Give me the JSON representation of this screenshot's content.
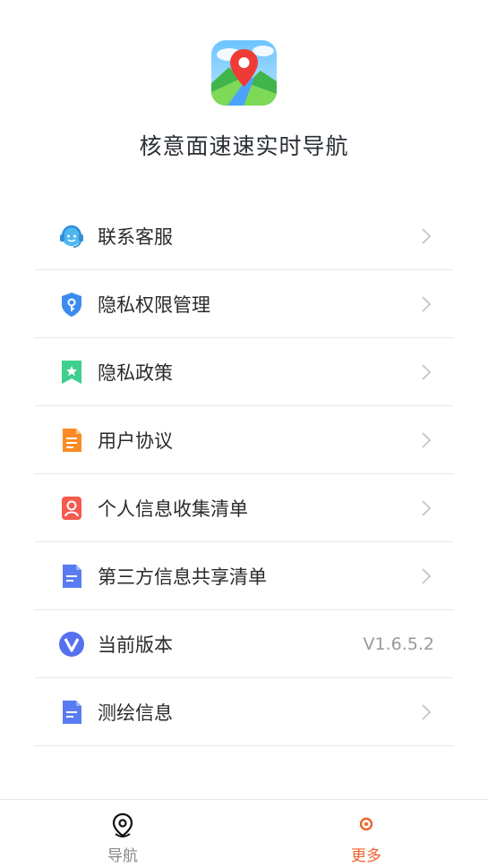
{
  "header": {
    "app_title": "核意面速速实时导航"
  },
  "menu": [
    {
      "label": "联系客服",
      "icon": "customer-service-icon"
    },
    {
      "label": "隐私权限管理",
      "icon": "shield-key-icon"
    },
    {
      "label": "隐私政策",
      "icon": "bookmark-star-icon"
    },
    {
      "label": "用户协议",
      "icon": "document-icon"
    },
    {
      "label": "个人信息收集清单",
      "icon": "person-card-icon"
    },
    {
      "label": "第三方信息共享清单",
      "icon": "list-document-icon"
    },
    {
      "label": "当前版本",
      "icon": "version-v-icon",
      "value": "V1.6.5.2"
    },
    {
      "label": "测绘信息",
      "icon": "list-document-icon"
    }
  ],
  "tabbar": {
    "tabs": [
      {
        "label": "导航",
        "icon": "map-pin-icon",
        "active": false
      },
      {
        "label": "更多",
        "icon": "more-icon",
        "active": true
      }
    ]
  },
  "colors": {
    "accent": "#f0632f",
    "divider": "#e9e9e9",
    "secondary_text": "#999999"
  }
}
